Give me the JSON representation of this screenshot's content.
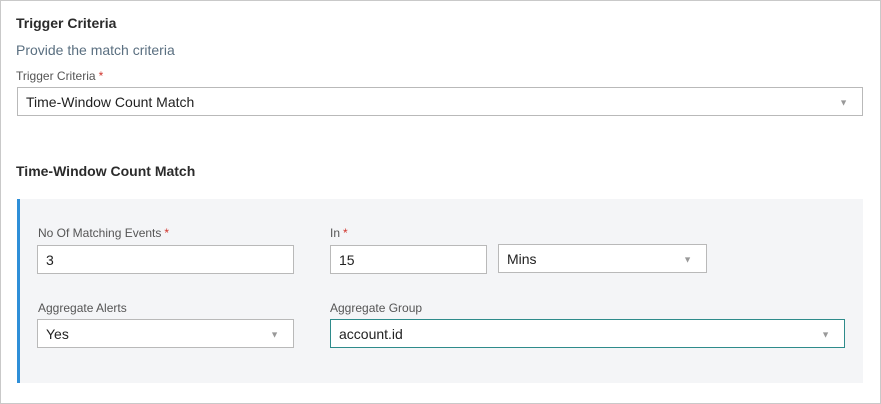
{
  "section1": {
    "title": "Trigger Criteria",
    "subtitle": "Provide the match criteria",
    "field_label": "Trigger Criteria",
    "required_mark": "*",
    "selected": "Time-Window Count Match",
    "caret": "▼"
  },
  "section2": {
    "title": "Time-Window Count Match",
    "matching_events": {
      "label": "No Of Matching Events",
      "required_mark": "*",
      "value": "3"
    },
    "in_field": {
      "label": "In",
      "required_mark": "*",
      "value": "15"
    },
    "unit": {
      "selected": "Mins",
      "caret": "▼"
    },
    "aggregate_alerts": {
      "label": "Aggregate Alerts",
      "selected": "Yes",
      "caret": "▼"
    },
    "aggregate_group": {
      "label": "Aggregate Group",
      "selected": "account.id",
      "caret": "▼"
    }
  },
  "colors": {
    "accent_bar": "#2f8fd8",
    "focus_border": "#2e8b8b",
    "required": "#d0342c"
  }
}
